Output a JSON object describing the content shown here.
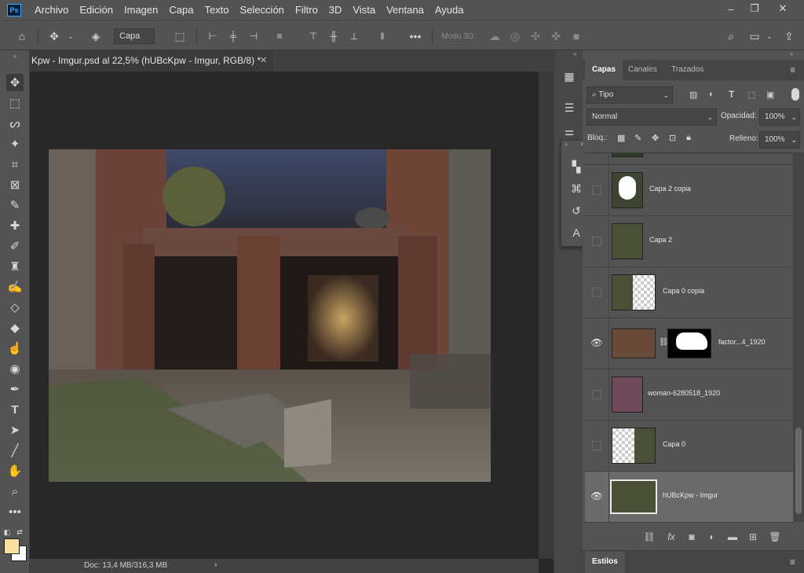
{
  "app": {
    "logo": "Ps",
    "menus": [
      "Archivo",
      "Edición",
      "Imagen",
      "Capa",
      "Texto",
      "Selección",
      "Filtro",
      "3D",
      "Vista",
      "Ventana",
      "Ayuda"
    ]
  },
  "options": {
    "auto_select_value": "Capa",
    "mode3d_label": "Modo 3D:"
  },
  "document": {
    "tab_title": "Kpw - Imgur.psd al 22,5% (hUBcKpw - Imgur, RGB/8) *",
    "status": "Doc: 13,4 MB/316,3 MB"
  },
  "layers_panel": {
    "tabs": [
      "Capas",
      "Canales",
      "Trazados"
    ],
    "filter_kind": "Tipo",
    "blend_mode": "Normal",
    "opacity_label": "Opacidad:",
    "opacity_value": "100%",
    "lock_label": "Bloq.:",
    "fill_label": "Relleno:",
    "fill_value": "100%",
    "layers": [
      {
        "name": "Capa 2 copia",
        "visible": false
      },
      {
        "name": "Capa 2",
        "visible": false
      },
      {
        "name": "Capa 0 copia",
        "visible": false
      },
      {
        "name": "factor...4_1920",
        "visible": true
      },
      {
        "name": "woman-6280518_1920",
        "visible": false
      },
      {
        "name": "Capa 0",
        "visible": false
      },
      {
        "name": "hUBcKpw - Imgur",
        "visible": true,
        "selected": true
      }
    ],
    "styles_tab": "Estilos"
  }
}
